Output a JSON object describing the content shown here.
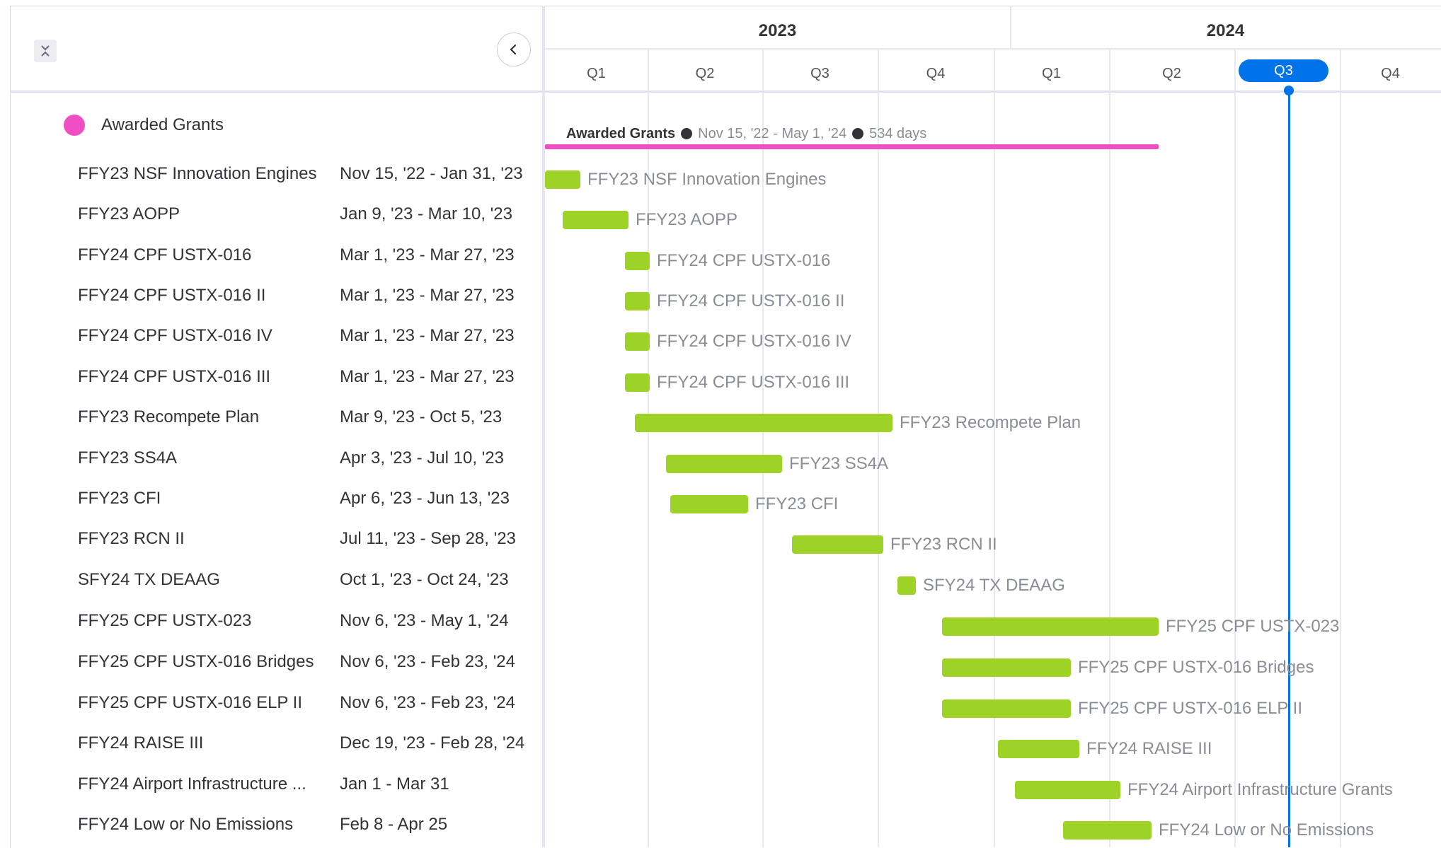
{
  "group": {
    "name": "Awarded Grants",
    "color": "#f04fc4"
  },
  "summary": {
    "name": "Awarded Grants",
    "range": "Nov 15, '22 - May 1, '24",
    "duration": "534 days"
  },
  "timeline": {
    "years": [
      "2023",
      "2024"
    ],
    "quarters": [
      "Q1",
      "Q2",
      "Q3",
      "Q4",
      "Q1",
      "Q2",
      "Q3",
      "Q4"
    ],
    "current_quarter_index": 6,
    "bar_color": "#9cd326",
    "today_color": "#0073ea"
  },
  "rows": [
    {
      "name": "FFY23 NSF Innovation Engines",
      "dates": "Nov 15, '22 - Jan 31, '23",
      "bar_label": "FFY23 NSF Innovation Engines"
    },
    {
      "name": "FFY23 AOPP",
      "dates": "Jan 9, '23 - Mar 10, '23",
      "bar_label": "FFY23 AOPP"
    },
    {
      "name": "FFY24 CPF USTX-016",
      "dates": "Mar 1, '23 - Mar 27, '23",
      "bar_label": "FFY24 CPF USTX-016"
    },
    {
      "name": "FFY24 CPF USTX-016 II",
      "dates": "Mar 1, '23 - Mar 27, '23",
      "bar_label": "FFY24 CPF USTX-016 II"
    },
    {
      "name": "FFY24 CPF USTX-016 IV",
      "dates": "Mar 1, '23 - Mar 27, '23",
      "bar_label": "FFY24 CPF USTX-016 IV"
    },
    {
      "name": "FFY24 CPF USTX-016 III",
      "dates": "Mar 1, '23 - Mar 27, '23",
      "bar_label": "FFY24 CPF USTX-016 III"
    },
    {
      "name": "FFY23 Recompete Plan",
      "dates": "Mar 9, '23 - Oct 5, '23",
      "bar_label": "FFY23 Recompete Plan"
    },
    {
      "name": "FFY23 SS4A",
      "dates": "Apr 3, '23 - Jul 10, '23",
      "bar_label": "FFY23 SS4A"
    },
    {
      "name": "FFY23 CFI",
      "dates": "Apr 6, '23 - Jun 13, '23",
      "bar_label": "FFY23 CFI"
    },
    {
      "name": "FFY23 RCN II",
      "dates": "Jul 11, '23 - Sep 28, '23",
      "bar_label": "FFY23 RCN II"
    },
    {
      "name": "SFY24 TX DEAAG",
      "dates": "Oct 1, '23 - Oct 24, '23",
      "bar_label": "SFY24 TX DEAAG"
    },
    {
      "name": "FFY25 CPF USTX-023",
      "dates": "Nov 6, '23 - May 1, '24",
      "bar_label": "FFY25 CPF USTX-023"
    },
    {
      "name": "FFY25 CPF USTX-016 Bridges",
      "dates": "Nov 6, '23 - Feb 23, '24",
      "bar_label": "FFY25 CPF USTX-016 Bridges"
    },
    {
      "name": "FFY25 CPF USTX-016 ELP II",
      "dates": "Nov 6, '23 - Feb 23, '24",
      "bar_label": "FFY25 CPF USTX-016 ELP II"
    },
    {
      "name": "FFY24 RAISE III",
      "dates": "Dec 19, '23 - Feb 28, '24",
      "bar_label": "FFY24 RAISE III"
    },
    {
      "name": "FFY24 Airport Infrastructure ...",
      "dates": "Jan 1 - Mar 31",
      "bar_label": "FFY24 Airport Infrastructure Grants"
    },
    {
      "name": "FFY24 Low or No Emissions",
      "dates": "Feb 8 - Apr 25",
      "bar_label": "FFY24 Low or No Emissions"
    }
  ]
}
